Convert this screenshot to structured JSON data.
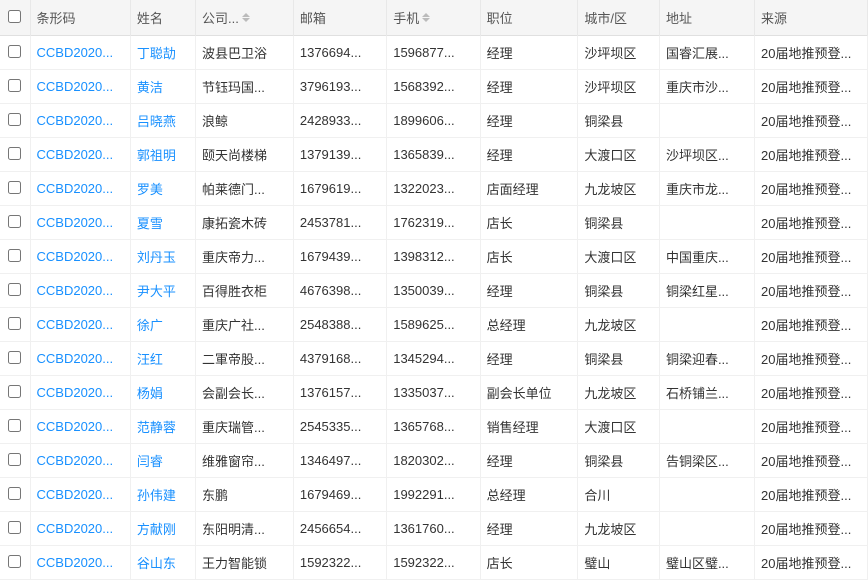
{
  "table": {
    "columns": [
      {
        "key": "checkbox",
        "label": "",
        "sortable": false
      },
      {
        "key": "barcode",
        "label": "条形码",
        "sortable": false
      },
      {
        "key": "name",
        "label": "姓名",
        "sortable": false
      },
      {
        "key": "company",
        "label": "公司...",
        "sortable": true
      },
      {
        "key": "email",
        "label": "邮箱",
        "sortable": false
      },
      {
        "key": "phone",
        "label": "手机",
        "sortable": true
      },
      {
        "key": "position",
        "label": "职位",
        "sortable": false
      },
      {
        "key": "city",
        "label": "城市/区",
        "sortable": false
      },
      {
        "key": "address",
        "label": "地址",
        "sortable": false
      },
      {
        "key": "source",
        "label": "来源",
        "sortable": false
      }
    ],
    "rows": [
      {
        "barcode": "CCBD2020...",
        "name": "丁聪劼",
        "company": "波县巴卫浴",
        "email": "1376694...",
        "phone": "1596877...",
        "position": "经理",
        "city": "沙坪坝区",
        "address": "国睿汇展...",
        "source": "20届地推预登..."
      },
      {
        "barcode": "CCBD2020...",
        "name": "黄洁",
        "company": "节钰玛国...",
        "email": "3796193...",
        "phone": "1568392...",
        "position": "经理",
        "city": "沙坪坝区",
        "address": "重庆市沙...",
        "source": "20届地推预登..."
      },
      {
        "barcode": "CCBD2020...",
        "name": "吕晓燕",
        "company": "浪鲸",
        "email": "2428933...",
        "phone": "1899606...",
        "position": "经理",
        "city": "铜梁县",
        "address": "",
        "source": "20届地推预登..."
      },
      {
        "barcode": "CCBD2020...",
        "name": "郭祖明",
        "company": "颐天尚楼梯",
        "email": "1379139...",
        "phone": "1365839...",
        "position": "经理",
        "city": "大渡口区",
        "address": "沙坪坝区...",
        "source": "20届地推预登..."
      },
      {
        "barcode": "CCBD2020...",
        "name": "罗美",
        "company": "帕莱德门...",
        "email": "1679619...",
        "phone": "1322023...",
        "position": "店面经理",
        "city": "九龙坡区",
        "address": "重庆市龙...",
        "source": "20届地推预登..."
      },
      {
        "barcode": "CCBD2020...",
        "name": "夏雪",
        "company": "康拓瓷木砖",
        "email": "2453781...",
        "phone": "1762319...",
        "position": "店长",
        "city": "铜梁县",
        "address": "",
        "source": "20届地推预登..."
      },
      {
        "barcode": "CCBD2020...",
        "name": "刘丹玉",
        "company": "重庆帝力...",
        "email": "1679439...",
        "phone": "1398312...",
        "position": "店长",
        "city": "大渡口区",
        "address": "中国重庆...",
        "source": "20届地推预登..."
      },
      {
        "barcode": "CCBD2020...",
        "name": "尹大平",
        "company": "百得胜衣柜",
        "email": "4676398...",
        "phone": "1350039...",
        "position": "经理",
        "city": "铜梁县",
        "address": "铜梁红星...",
        "source": "20届地推预登..."
      },
      {
        "barcode": "CCBD2020...",
        "name": "徐广",
        "company": "重庆广社...",
        "email": "2548388...",
        "phone": "1589625...",
        "position": "总经理",
        "city": "九龙坡区",
        "address": "",
        "source": "20届地推预登..."
      },
      {
        "barcode": "CCBD2020...",
        "name": "汪红",
        "company": "二軍帝股...",
        "email": "4379168...",
        "phone": "1345294...",
        "position": "经理",
        "city": "铜梁县",
        "address": "铜梁迎春...",
        "source": "20届地推预登..."
      },
      {
        "barcode": "CCBD2020...",
        "name": "杨娟",
        "company": "会副会长...",
        "email": "1376157...",
        "phone": "1335037...",
        "position": "副会长单位",
        "city": "九龙坡区",
        "address": "石桥铺兰...",
        "source": "20届地推预登..."
      },
      {
        "barcode": "CCBD2020...",
        "name": "范静蓉",
        "company": "重庆瑞管...",
        "email": "2545335...",
        "phone": "1365768...",
        "position": "销售经理",
        "city": "大渡口区",
        "address": "",
        "source": "20届地推预登..."
      },
      {
        "barcode": "CCBD2020...",
        "name": "闫睿",
        "company": "维雅窗帘...",
        "email": "1346497...",
        "phone": "1820302...",
        "position": "经理",
        "city": "铜梁县",
        "address": "告铜梁区...",
        "source": "20届地推预登..."
      },
      {
        "barcode": "CCBD2020...",
        "name": "孙伟建",
        "company": "东鹏",
        "email": "1679469...",
        "phone": "1992291...",
        "position": "总经理",
        "city": "合川",
        "address": "",
        "source": "20届地推预登..."
      },
      {
        "barcode": "CCBD2020...",
        "name": "方献刚",
        "company": "东阳明清...",
        "email": "2456654...",
        "phone": "1361760...",
        "position": "经理",
        "city": "九龙坡区",
        "address": "",
        "source": "20届地推预登..."
      },
      {
        "barcode": "CCBD2020...",
        "name": "谷山东",
        "company": "王力智能锁",
        "email": "1592322...",
        "phone": "1592322...",
        "position": "店长",
        "city": "璧山",
        "address": "璧山区璧...",
        "source": "20届地推预登..."
      }
    ]
  }
}
